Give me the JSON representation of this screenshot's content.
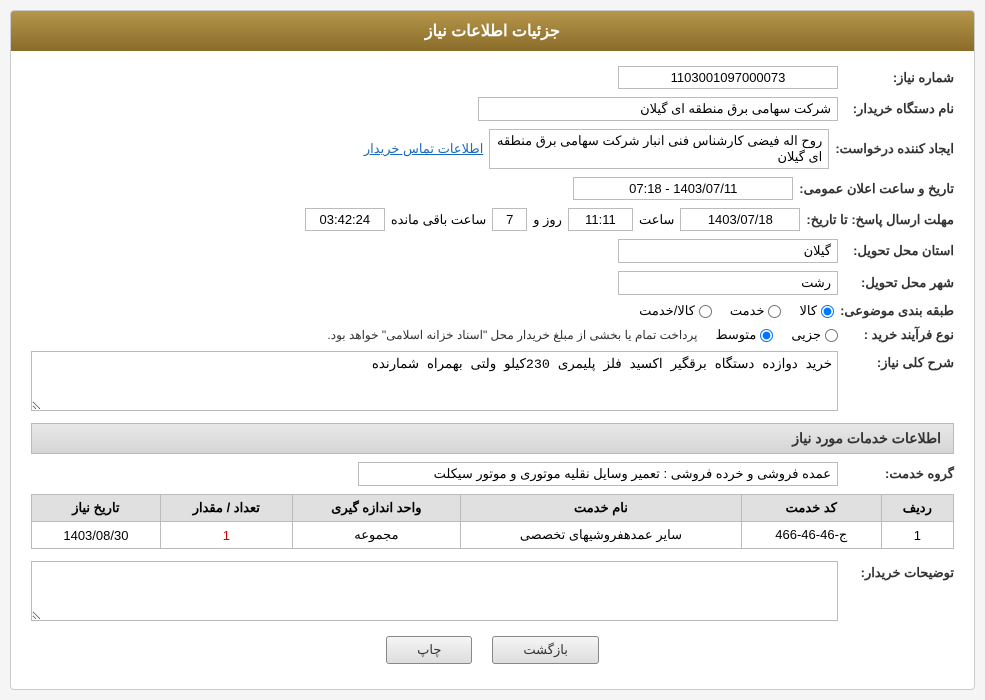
{
  "header": {
    "title": "جزئیات اطلاعات نیاز"
  },
  "fields": {
    "need_number_label": "شماره نیاز:",
    "need_number_value": "1103001097000073",
    "buyer_org_label": "نام دستگاه خریدار:",
    "buyer_org_value": "شرکت سهامی برق منطقه ای گیلان",
    "creator_label": "ایجاد کننده درخواست:",
    "creator_value": "روح اله فیضی کارشناس فنی انبار شرکت سهامی برق منطقه ای گیلان",
    "creator_link": "اطلاعات تماس خریدار",
    "date_time_label": "تاریخ و ساعت اعلان عمومی:",
    "date_time_value": "1403/07/11 - 07:18",
    "reply_deadline_label": "مهلت ارسال پاسخ: تا تاریخ:",
    "reply_date": "1403/07/18",
    "reply_time_label": "ساعت",
    "reply_time_value": "11:11",
    "reply_days_label": "روز و",
    "reply_days_value": "7",
    "reply_remaining_label": "ساعت باقی مانده",
    "reply_remaining_value": "03:42:24",
    "province_label": "استان محل تحویل:",
    "province_value": "گیلان",
    "city_label": "شهر محل تحویل:",
    "city_value": "رشت",
    "category_label": "طبقه بندی موضوعی:",
    "cat_option1": "کالا",
    "cat_option2": "خدمت",
    "cat_option3": "کالا/خدمت",
    "cat_selected": "کالا",
    "purchase_type_label": "نوع فرآیند خرید :",
    "type_option1": "جزیی",
    "type_option2": "متوسط",
    "type_note": "پرداخت تمام یا بخشی از مبلغ خریدار محل \"اسناد خزانه اسلامی\" خواهد بود.",
    "general_desc_section": "شرح کلی نیاز:",
    "general_desc_value": "خرید دوازده دستگاه برقگیر اکسید فلز پلیمری 230کیلو ولتی بهمراه شمارنده",
    "services_section": "اطلاعات خدمات مورد نیاز",
    "service_group_label": "گروه خدمت:",
    "service_group_value": "عمده فروشی و خرده فروشی : تعمیر وسایل نقلیه موتوری و موتور سیکلت",
    "buyer_note_label": "توضیحات خریدار:",
    "buyer_note_value": "",
    "btn_print": "چاپ",
    "btn_back": "بازگشت"
  },
  "table": {
    "columns": [
      "ردیف",
      "کد خدمت",
      "نام خدمت",
      "واحد اندازه گیری",
      "تعداد / مقدار",
      "تاریخ نیاز"
    ],
    "rows": [
      {
        "row": "1",
        "code": "ج-46-46-466",
        "name": "سایر عمدهفروشیهای تخصصی",
        "unit": "مجموعه",
        "qty": "1",
        "date": "1403/08/30"
      }
    ]
  }
}
